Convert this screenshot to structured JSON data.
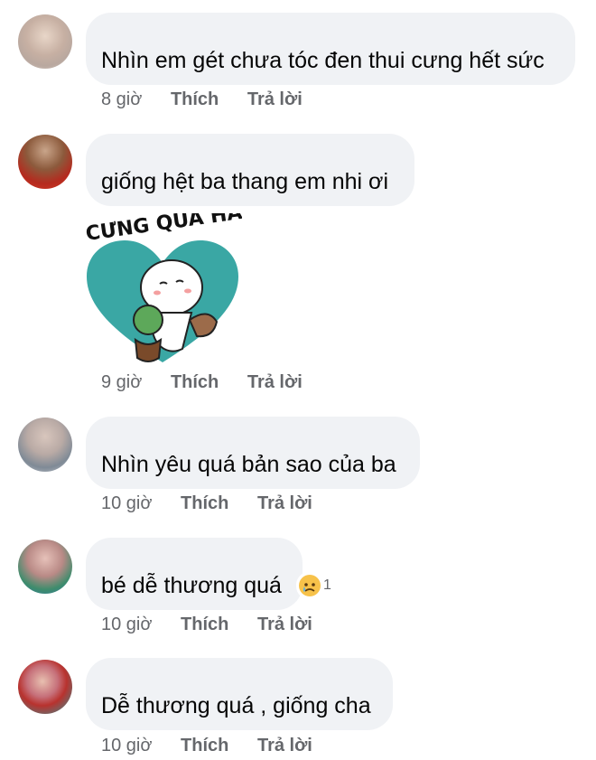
{
  "comments": [
    {
      "text": "Nhìn em gét chưa tóc đen thui cưng hết sức",
      "time": "8 giờ",
      "like": "Thích",
      "reply": "Trả lời"
    },
    {
      "text": "giống hệt ba thang em nhi ơi",
      "time": "9 giờ",
      "like": "Thích",
      "reply": "Trả lời",
      "sticker": {
        "text": "CƯNG QUÁ HÀ",
        "name": "cung-qua-ha-sticker"
      }
    },
    {
      "text": "Nhìn yêu quá bản sao của ba",
      "time": "10 giờ",
      "like": "Thích",
      "reply": "Trả lời"
    },
    {
      "text": "bé dễ thương quá",
      "time": "10 giờ",
      "like": "Thích",
      "reply": "Trả lời",
      "reaction": {
        "icon": "sad-face-icon",
        "count": "1"
      }
    },
    {
      "text": "Dễ thương quá , giống cha",
      "time": "10 giờ",
      "like": "Thích",
      "reply": "Trả lời"
    }
  ],
  "colors": {
    "bubble": "#f0f2f5",
    "meta": "#65676b",
    "text": "#050505",
    "sticker_heart": "#3aa7a4"
  }
}
